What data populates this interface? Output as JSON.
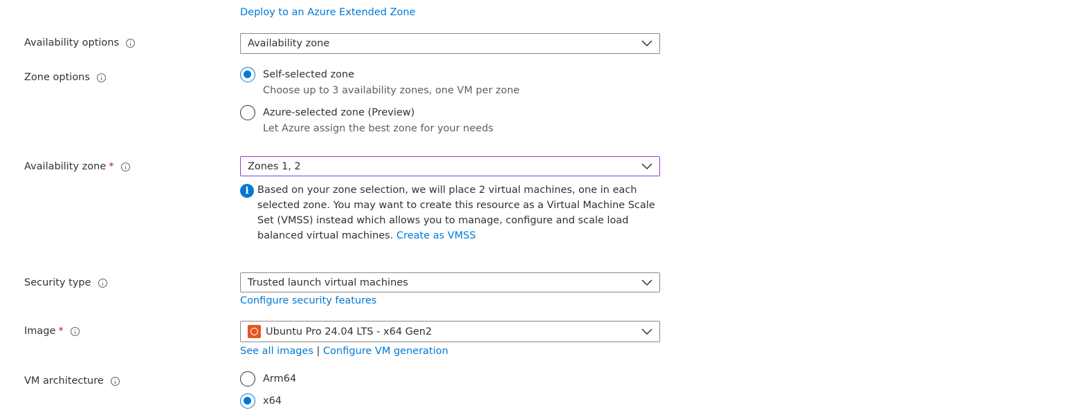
{
  "top_link": "Deploy to an Azure Extended Zone",
  "availability_options": {
    "label": "Availability options",
    "value": "Availability zone"
  },
  "zone_options": {
    "label": "Zone options",
    "options": [
      {
        "label": "Self-selected zone",
        "description": "Choose up to 3 availability zones, one VM per zone",
        "selected": true
      },
      {
        "label": "Azure-selected zone (Preview)",
        "description": "Let Azure assign the best zone for your needs",
        "selected": false
      }
    ]
  },
  "availability_zone": {
    "label": "Availability zone",
    "required_mark": "*",
    "value": "Zones 1, 2",
    "info_icon": "i",
    "info_text": "Based on your zone selection, we will place 2 virtual machines, one in each selected zone. You may want to create this resource as a Virtual Machine Scale Set (VMSS) instead which allows you to manage, configure and scale load balanced virtual machines.",
    "info_link": "Create as VMSS"
  },
  "security_type": {
    "label": "Security type",
    "value": "Trusted launch virtual machines",
    "link": "Configure security features"
  },
  "image": {
    "label": "Image",
    "required_mark": "*",
    "value": "Ubuntu Pro 24.04 LTS - x64 Gen2",
    "icon": "ubuntu-logo-icon",
    "links": [
      "See all images",
      "Configure VM generation"
    ],
    "separator": "|"
  },
  "vm_architecture": {
    "label": "VM architecture",
    "options": [
      {
        "label": "Arm64",
        "selected": false
      },
      {
        "label": "x64",
        "selected": true
      }
    ]
  },
  "colors": {
    "link": "#0078d4",
    "radio_selected": "#0078d4",
    "required": "#a4262c",
    "focused_border": "#8a3dd4",
    "ubuntu": "#e95420"
  }
}
